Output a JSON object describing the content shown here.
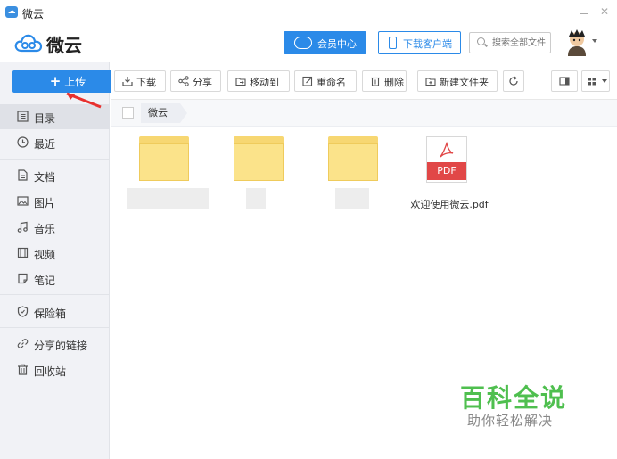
{
  "window": {
    "title": "微云"
  },
  "header": {
    "logo_text": "微云",
    "member_label": "会员中心",
    "download_client_label": "下载客户端",
    "search_placeholder": "搜索全部文件"
  },
  "sidebar": {
    "upload_label": "上传",
    "items": [
      {
        "label": "目录",
        "icon": "list-icon"
      },
      {
        "label": "最近",
        "icon": "clock-icon"
      },
      {
        "label": "文档",
        "icon": "document-icon"
      },
      {
        "label": "图片",
        "icon": "image-icon"
      },
      {
        "label": "音乐",
        "icon": "music-icon"
      },
      {
        "label": "视频",
        "icon": "video-icon"
      },
      {
        "label": "笔记",
        "icon": "note-icon"
      },
      {
        "label": "保险箱",
        "icon": "shield-icon"
      },
      {
        "label": "分享的链接",
        "icon": "link-icon"
      },
      {
        "label": "回收站",
        "icon": "trash-icon"
      }
    ]
  },
  "toolbar": {
    "download": "下载",
    "share": "分享",
    "move_to": "移动到",
    "rename": "重命名",
    "delete": "删除",
    "new_folder": "新建文件夹"
  },
  "breadcrumb": {
    "current": "微云"
  },
  "files": [
    {
      "type": "folder",
      "name": ""
    },
    {
      "type": "folder",
      "name": ""
    },
    {
      "type": "folder",
      "name": ""
    },
    {
      "type": "pdf",
      "badge": "PDF",
      "name": "欢迎使用微云.pdf"
    }
  ],
  "watermark": {
    "title": "百科全说",
    "subtitle": "助你轻松解决"
  },
  "colors": {
    "accent": "#2b8ae8",
    "pdf": "#e14747",
    "folder": "#fbe38a",
    "watermark": "#4fbf4f"
  }
}
